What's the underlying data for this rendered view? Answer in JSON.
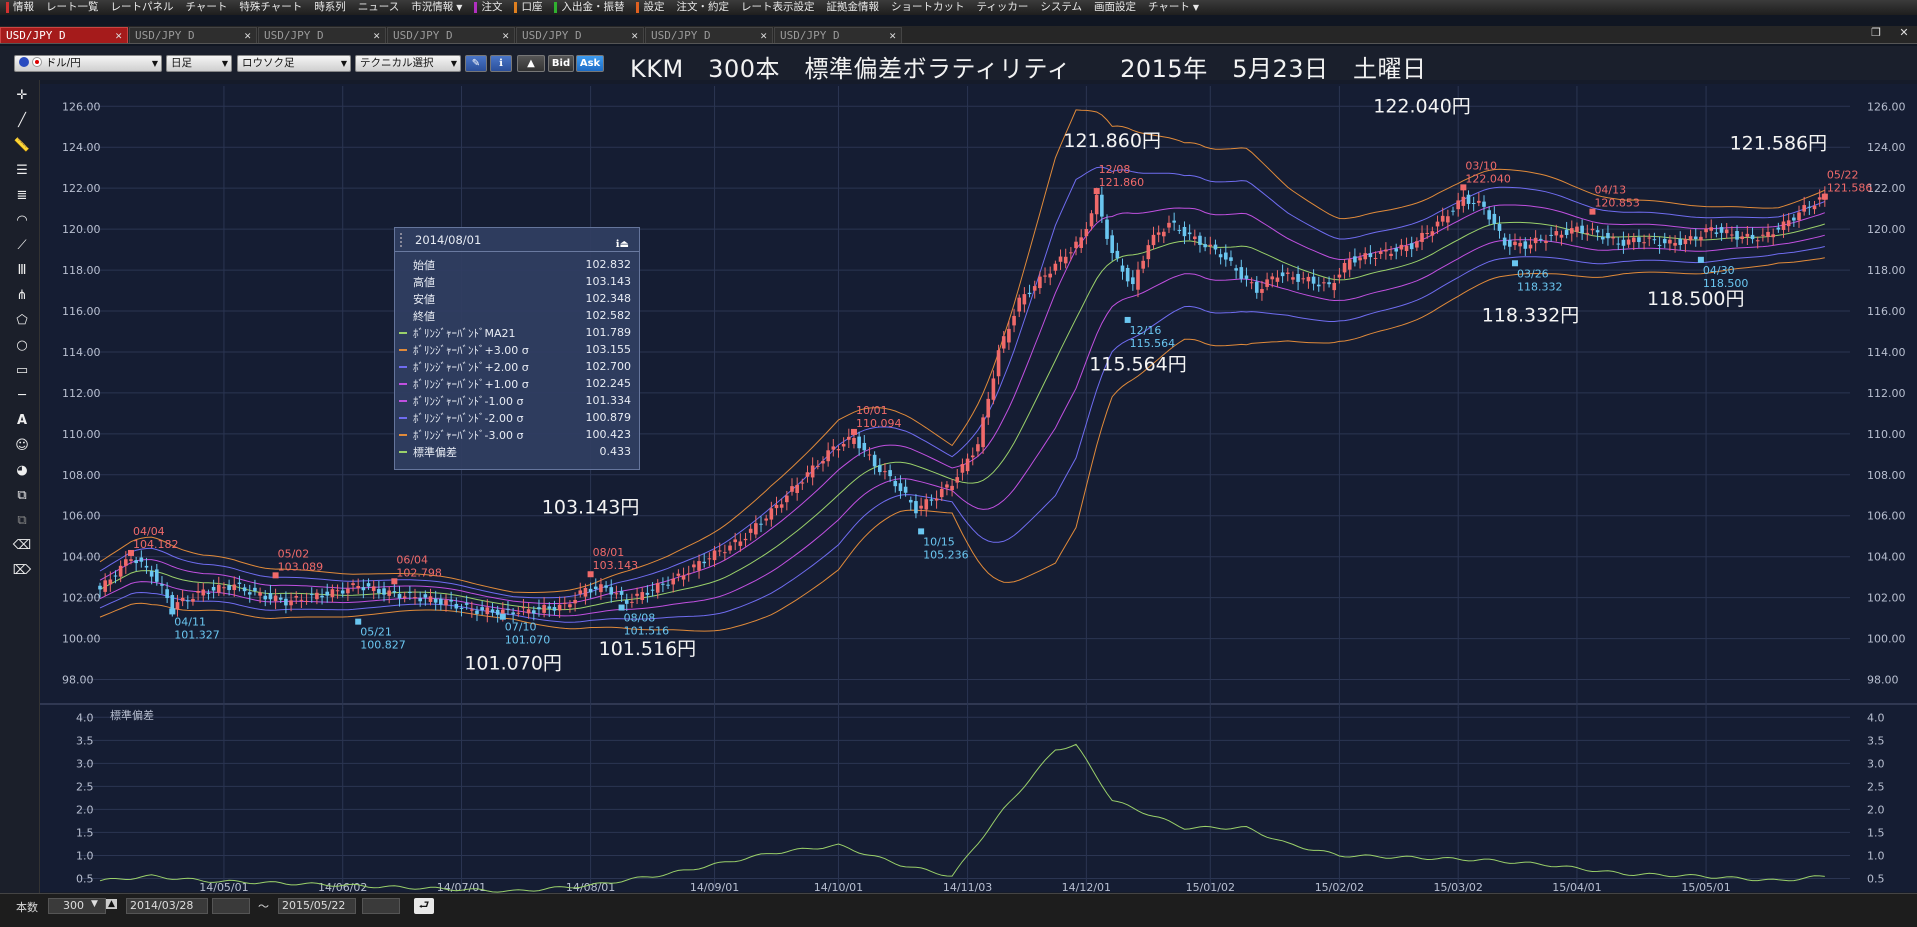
{
  "menubar": {
    "items": [
      {
        "label": "情報",
        "mark": "#d03030"
      },
      {
        "label": "レート一覧"
      },
      {
        "label": "レートパネル"
      },
      {
        "label": "チャート"
      },
      {
        "label": "特殊チャート"
      },
      {
        "label": "時系列"
      },
      {
        "label": "ニュース"
      },
      {
        "label": "市況情報",
        "dropdown": true
      },
      {
        "label": "注文",
        "mark": "#b030c0"
      },
      {
        "label": "口座",
        "mark": "#e08020"
      },
      {
        "label": "入出金・振替",
        "mark": "#30b030"
      },
      {
        "label": "設定",
        "mark": "#e06020"
      },
      {
        "label": "注文・約定"
      },
      {
        "label": "レート表示設定"
      },
      {
        "label": "証拠金情報"
      },
      {
        "label": "ショートカット"
      },
      {
        "label": "ティッカー"
      },
      {
        "label": "システム"
      },
      {
        "label": "画面設定"
      },
      {
        "label": "チャート",
        "dropdown": true
      }
    ]
  },
  "tabs": [
    {
      "label": "USD/JPY D",
      "active": true
    },
    {
      "label": "USD/JPY D"
    },
    {
      "label": "USD/JPY D"
    },
    {
      "label": "USD/JPY D"
    },
    {
      "label": "USD/JPY D"
    },
    {
      "label": "USD/JPY D"
    },
    {
      "label": "USD/JPY D"
    }
  ],
  "toolbar": {
    "currency": "ドル/円",
    "period": "日足",
    "chart_type": "ロウソク足",
    "technical": "テクニカル選択",
    "bid": "Bid",
    "ask": "Ask"
  },
  "title": "KKM　300本　標準偏差ボラティリティ　　2015年　5月23日　土曜日",
  "info_panel": {
    "date": "2014/08/01",
    "rows": [
      {
        "label": "始値",
        "value": "102.832"
      },
      {
        "label": "高値",
        "value": "103.143"
      },
      {
        "label": "安値",
        "value": "102.348"
      },
      {
        "label": "終値",
        "value": "102.582"
      },
      {
        "label": "ﾎﾞﾘﾝｼﾞｬｰﾊﾞﾝﾄﾞMA21",
        "value": "101.789",
        "color": "#9ad06a"
      },
      {
        "label": "ﾎﾞﾘﾝｼﾞｬｰﾊﾞﾝﾄﾞ+3.00 σ",
        "value": "103.155",
        "color": "#e08a3a"
      },
      {
        "label": "ﾎﾞﾘﾝｼﾞｬｰﾊﾞﾝﾄﾞ+2.00 σ",
        "value": "102.700",
        "color": "#6f6cf0"
      },
      {
        "label": "ﾎﾞﾘﾝｼﾞｬｰﾊﾞﾝﾄﾞ+1.00 σ",
        "value": "102.245",
        "color": "#c050e0"
      },
      {
        "label": "ﾎﾞﾘﾝｼﾞｬｰﾊﾞﾝﾄﾞ-1.00 σ",
        "value": "101.334",
        "color": "#c050e0"
      },
      {
        "label": "ﾎﾞﾘﾝｼﾞｬｰﾊﾞﾝﾄﾞ-2.00 σ",
        "value": "100.879",
        "color": "#6f6cf0"
      },
      {
        "label": "ﾎﾞﾘﾝｼﾞｬｰﾊﾞﾝﾄﾞ-3.00 σ",
        "value": "100.423",
        "color": "#e08a3a"
      },
      {
        "label": "標準偏差",
        "value": "0.433",
        "color": "#9ad06a"
      }
    ]
  },
  "statusbar": {
    "count_label": "本数",
    "count": "300",
    "from": "2014/03/28",
    "tilde": "～",
    "to": "2015/05/22"
  },
  "colors": {
    "up": "#f06a6a",
    "down": "#6ac6f0",
    "ma": "#9ad06a",
    "sigma1": "#c050e0",
    "sigma2": "#6f6cf0",
    "sigma3": "#e08a3a",
    "stdev": "#9ad06a",
    "bg": "#151d33",
    "grid": "#2b3552"
  },
  "chart_data": [
    {
      "type": "line",
      "title": "",
      "y_ticks": [
        "126.00",
        "124.00",
        "122.00",
        "120.00",
        "118.00",
        "116.00",
        "114.00",
        "112.00",
        "110.00",
        "108.00",
        "106.00",
        "104.00",
        "102.00",
        "100.00",
        "98.00"
      ],
      "ylim": [
        97,
        126.6
      ],
      "x_ticks": [
        {
          "label": "14/05/01",
          "idx": 24
        },
        {
          "label": "14/06/02",
          "idx": 47
        },
        {
          "label": "14/07/01",
          "idx": 70
        },
        {
          "label": "14/08/01",
          "idx": 95
        },
        {
          "label": "14/09/01",
          "idx": 119
        },
        {
          "label": "14/10/01",
          "idx": 143
        },
        {
          "label": "14/11/03",
          "idx": 168
        },
        {
          "label": "14/12/01",
          "idx": 191
        },
        {
          "label": "15/01/02",
          "idx": 215
        },
        {
          "label": "15/02/02",
          "idx": 240
        },
        {
          "label": "15/03/02",
          "idx": 263
        },
        {
          "label": "15/04/01",
          "idx": 286
        },
        {
          "label": "15/05/01",
          "idx": 311
        }
      ],
      "n_bars": 335,
      "close_anchors": [
        [
          0,
          102.4
        ],
        [
          6,
          104.0
        ],
        [
          10,
          103.2
        ],
        [
          14,
          101.6
        ],
        [
          20,
          102.3
        ],
        [
          26,
          102.6
        ],
        [
          30,
          102.2
        ],
        [
          36,
          101.8
        ],
        [
          40,
          102.0
        ],
        [
          46,
          102.3
        ],
        [
          50,
          102.6
        ],
        [
          56,
          102.2
        ],
        [
          62,
          102.0
        ],
        [
          68,
          101.7
        ],
        [
          72,
          101.4
        ],
        [
          78,
          101.3
        ],
        [
          84,
          101.4
        ],
        [
          90,
          101.6
        ],
        [
          94,
          102.4
        ],
        [
          98,
          102.5
        ],
        [
          102,
          101.8
        ],
        [
          106,
          102.3
        ],
        [
          112,
          103.0
        ],
        [
          118,
          104.0
        ],
        [
          124,
          104.8
        ],
        [
          130,
          106.2
        ],
        [
          136,
          107.8
        ],
        [
          142,
          109.3
        ],
        [
          146,
          109.8
        ],
        [
          150,
          108.5
        ],
        [
          154,
          107.6
        ],
        [
          158,
          106.3
        ],
        [
          161,
          106.8
        ],
        [
          165,
          107.6
        ],
        [
          170,
          109.5
        ],
        [
          174,
          114.0
        ],
        [
          178,
          116.5
        ],
        [
          184,
          118.0
        ],
        [
          190,
          119.5
        ],
        [
          193,
          121.5
        ],
        [
          196,
          118.8
        ],
        [
          200,
          117.2
        ],
        [
          203,
          119.3
        ],
        [
          207,
          120.3
        ],
        [
          212,
          119.5
        ],
        [
          217,
          118.8
        ],
        [
          220,
          118.0
        ],
        [
          224,
          117.0
        ],
        [
          228,
          117.8
        ],
        [
          234,
          117.5
        ],
        [
          238,
          117.2
        ],
        [
          242,
          118.5
        ],
        [
          248,
          118.8
        ],
        [
          254,
          119.2
        ],
        [
          260,
          120.5
        ],
        [
          264,
          121.5
        ],
        [
          268,
          121.1
        ],
        [
          272,
          119.3
        ],
        [
          276,
          119.2
        ],
        [
          280,
          119.6
        ],
        [
          286,
          120.0
        ],
        [
          290,
          119.8
        ],
        [
          294,
          119.3
        ],
        [
          298,
          119.5
        ],
        [
          304,
          119.3
        ],
        [
          308,
          119.5
        ],
        [
          312,
          120.0
        ],
        [
          318,
          119.6
        ],
        [
          322,
          119.6
        ],
        [
          326,
          120.2
        ],
        [
          330,
          121.0
        ],
        [
          334,
          121.6
        ]
      ],
      "bb_width": [
        [
          0,
          0.45
        ],
        [
          10,
          0.55
        ],
        [
          20,
          0.45
        ],
        [
          40,
          0.38
        ],
        [
          60,
          0.3
        ],
        [
          80,
          0.22
        ],
        [
          95,
          0.35
        ],
        [
          110,
          0.6
        ],
        [
          130,
          1.05
        ],
        [
          143,
          1.22
        ],
        [
          155,
          0.8
        ],
        [
          165,
          0.55
        ],
        [
          175,
          2.0
        ],
        [
          185,
          3.3
        ],
        [
          189,
          3.4
        ],
        [
          196,
          2.2
        ],
        [
          210,
          1.6
        ],
        [
          222,
          1.6
        ],
        [
          230,
          1.25
        ],
        [
          240,
          1.0
        ],
        [
          255,
          0.95
        ],
        [
          268,
          0.9
        ],
        [
          280,
          0.8
        ],
        [
          295,
          0.6
        ],
        [
          310,
          0.55
        ],
        [
          325,
          0.45
        ],
        [
          334,
          0.55
        ]
      ],
      "annotations": [
        {
          "idx": 6,
          "price": 104.182,
          "date": "04/04",
          "value": "104.182",
          "kind": "high"
        },
        {
          "idx": 14,
          "price": 101.327,
          "date": "04/11",
          "value": "101.327",
          "kind": "low"
        },
        {
          "idx": 34,
          "price": 103.089,
          "date": "05/02",
          "value": "103.089",
          "kind": "high"
        },
        {
          "idx": 50,
          "price": 100.827,
          "date": "05/21",
          "value": "100.827",
          "kind": "low"
        },
        {
          "idx": 57,
          "price": 102.798,
          "date": "06/04",
          "value": "102.798",
          "kind": "high"
        },
        {
          "idx": 78,
          "price": 101.07,
          "date": "07/10",
          "value": "101.070",
          "kind": "low"
        },
        {
          "idx": 95,
          "price": 103.143,
          "date": "08/01",
          "value": "103.143",
          "kind": "high"
        },
        {
          "idx": 101,
          "price": 101.516,
          "date": "08/08",
          "value": "101.516",
          "kind": "low"
        },
        {
          "idx": 146,
          "price": 110.094,
          "date": "10/01",
          "value": "110.094",
          "kind": "high"
        },
        {
          "idx": 159,
          "price": 105.236,
          "date": "10/15",
          "value": "105.236",
          "kind": "low"
        },
        {
          "idx": 193,
          "price": 121.86,
          "date": "12/08",
          "value": "121.860",
          "kind": "high"
        },
        {
          "idx": 199,
          "price": 115.564,
          "date": "12/16",
          "value": "115.564",
          "kind": "low"
        },
        {
          "idx": 264,
          "price": 122.04,
          "date": "03/10",
          "value": "122.040",
          "kind": "high"
        },
        {
          "idx": 274,
          "price": 118.332,
          "date": "03/26",
          "value": "118.332",
          "kind": "low"
        },
        {
          "idx": 289,
          "price": 120.853,
          "date": "04/13",
          "value": "120.853",
          "kind": "high"
        },
        {
          "idx": 310,
          "price": 118.5,
          "date": "04/30",
          "value": "118.500",
          "kind": "low"
        },
        {
          "idx": 334,
          "price": 121.586,
          "date": "05/22",
          "value": "121.586",
          "kind": "high"
        }
      ],
      "big_labels": [
        {
          "text": "103.143円",
          "idx": 95,
          "price": 106.1
        },
        {
          "text": "101.070円",
          "idx": 80,
          "price": 98.5
        },
        {
          "text": "101.516円",
          "idx": 106,
          "price": 99.2
        },
        {
          "text": "121.860円",
          "idx": 196,
          "price": 124.0
        },
        {
          "text": "115.564円",
          "idx": 201,
          "price": 113.1
        },
        {
          "text": "122.040円",
          "idx": 256,
          "price": 125.7
        },
        {
          "text": "118.332円",
          "idx": 277,
          "price": 115.5
        },
        {
          "text": "118.500円",
          "idx": 309,
          "price": 116.3
        },
        {
          "text": "121.586円",
          "idx": 325,
          "price": 123.9
        }
      ]
    },
    {
      "type": "line",
      "title": "標準偏差",
      "y_ticks": [
        "4.0",
        "3.5",
        "3.0",
        "2.5",
        "2.0",
        "1.5",
        "1.0",
        "0.5"
      ],
      "ylim": [
        0.25,
        4.05
      ],
      "series": [
        {
          "x": [
            0,
            10,
            20,
            40,
            60,
            80,
            95,
            110,
            130,
            143,
            155,
            165,
            175,
            185,
            189,
            196,
            210,
            222,
            230,
            240,
            255,
            268,
            280,
            295,
            310,
            325,
            334
          ],
          "values": [
            0.45,
            0.55,
            0.45,
            0.38,
            0.3,
            0.22,
            0.35,
            0.6,
            1.05,
            1.22,
            0.8,
            0.55,
            2.0,
            3.3,
            3.4,
            2.2,
            1.6,
            1.6,
            1.25,
            1.0,
            0.95,
            0.9,
            0.8,
            0.6,
            0.55,
            0.45,
            0.55
          ]
        }
      ]
    }
  ]
}
